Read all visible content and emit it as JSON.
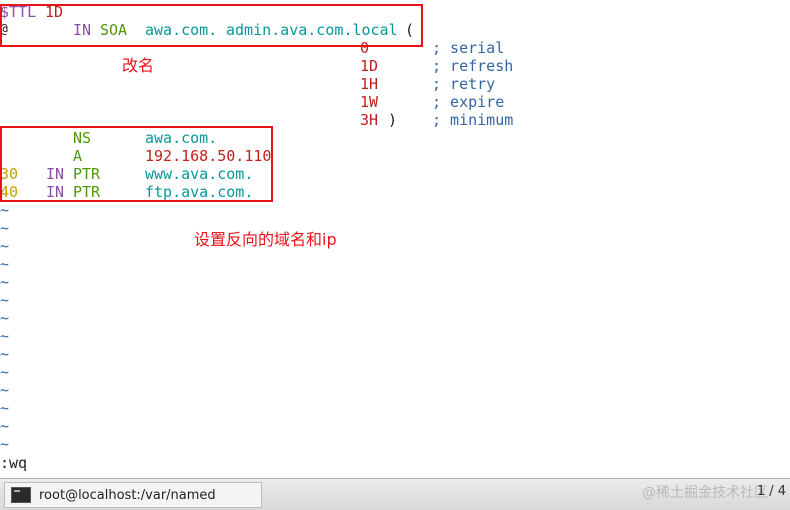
{
  "editor": {
    "ttl": {
      "keyword": "$TTL",
      "value": "1D"
    },
    "soa": {
      "at": "@",
      "class": "IN",
      "type": "SOA",
      "primary": "awa.com.",
      "admin": "admin.ava.com.local",
      "paren": "("
    },
    "soa_values": [
      {
        "value": "0",
        "comment": "; serial"
      },
      {
        "value": "1D",
        "comment": "; refresh"
      },
      {
        "value": "1H",
        "comment": "; retry"
      },
      {
        "value": "1W",
        "comment": "; expire"
      },
      {
        "value": "3H",
        "close": ")",
        "comment": "; minimum"
      }
    ],
    "records": [
      {
        "name": "",
        "class": "",
        "type": "NS",
        "data": "awa.com."
      },
      {
        "name": "",
        "class": "",
        "type": "A",
        "data": "192.168.50.110"
      },
      {
        "name": "30",
        "class": "IN",
        "type": "PTR",
        "data": "www.ava.com."
      },
      {
        "name": "40",
        "class": "IN",
        "type": "PTR",
        "data": "ftp.ava.com."
      }
    ],
    "tilde": "~",
    "command": ":wq"
  },
  "annotations": {
    "rename": "改名",
    "reverse": "设置反向的域名和ip"
  },
  "taskbar": {
    "window_label": "root@localhost:/var/named",
    "icon": "terminal-icon"
  },
  "watermark": "@稀土掘金技术社区",
  "pager": "1 / 4",
  "colors": {
    "annotation": "#e8141a",
    "keyword": "#8a4fa8",
    "number": "#c0201c",
    "type": "#4f9a06",
    "domain": "#06989a",
    "comment": "#3465a4"
  }
}
